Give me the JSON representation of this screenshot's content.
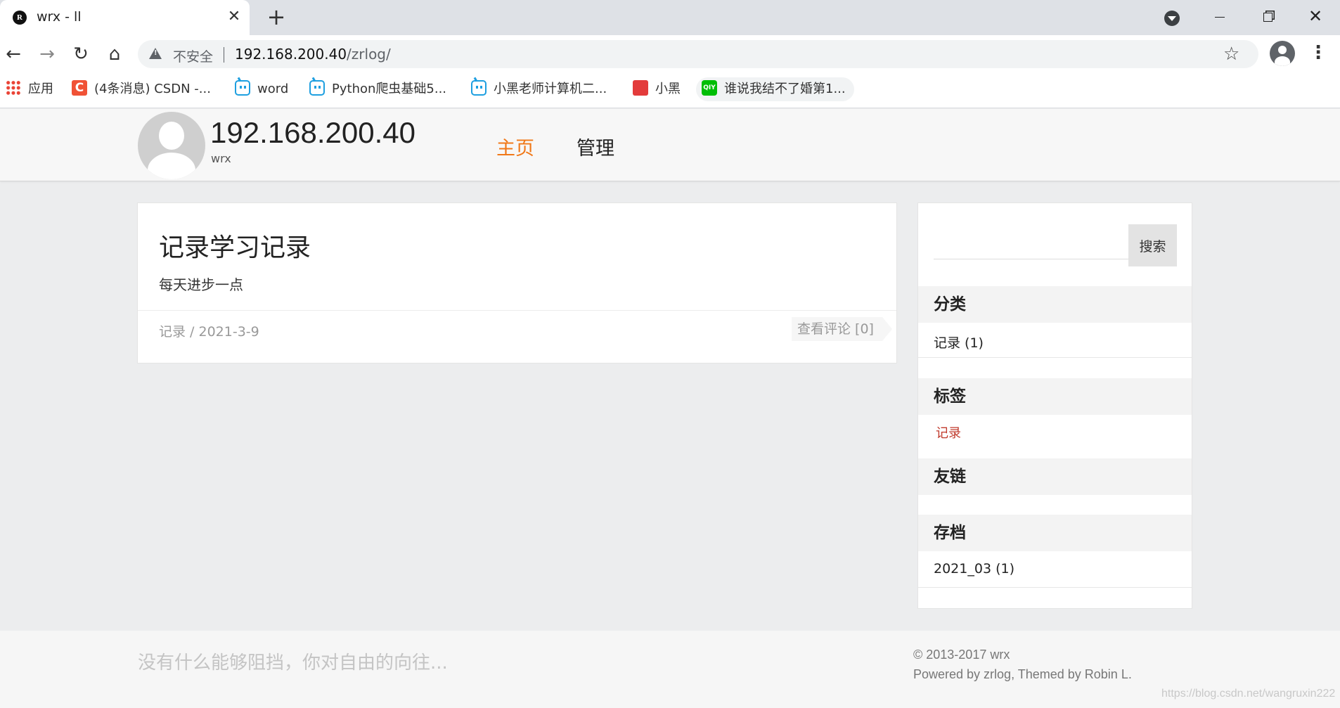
{
  "browser": {
    "tab_title": "wrx - ll",
    "tab_favicon_letter": "R",
    "new_tab": "+",
    "close_tab": "✕",
    "insecure_label": "不安全",
    "url_host": "192.168.200.40",
    "url_path": "/zrlog/",
    "bookmarks": [
      {
        "label": "应用",
        "icon": "apps-grid-icon"
      },
      {
        "label": "(4条消息) CSDN -...",
        "icon": "csdn-icon"
      },
      {
        "label": "word",
        "icon": "bilibili-icon"
      },
      {
        "label": "Python爬虫基础5...",
        "icon": "bilibili-icon"
      },
      {
        "label": "小黑老师计算机二...",
        "icon": "bilibili-icon"
      },
      {
        "label": "小黑",
        "icon": "bookmark-red-icon"
      },
      {
        "label": "谁说我结不了婚第1...",
        "icon": "iqiyi-icon"
      }
    ]
  },
  "site": {
    "title": "192.168.200.40",
    "subtitle": "wrx",
    "nav": {
      "home": "主页",
      "admin": "管理"
    },
    "accent_color": "#f07818"
  },
  "post": {
    "title": "记录学习记录",
    "excerpt": "每天进步一点",
    "meta": "记录 / 2021-3-9",
    "comments_link": "查看评论 [0]"
  },
  "sidebar": {
    "search_button": "搜索",
    "categories": {
      "heading": "分类",
      "items": [
        "记录 (1)"
      ]
    },
    "tags": {
      "heading": "标签",
      "items": [
        "记录"
      ]
    },
    "links": {
      "heading": "友链"
    },
    "archive": {
      "heading": "存档",
      "items": [
        "2021_03 (1)"
      ]
    }
  },
  "footer": {
    "motto": "没有什么能够阻挡，你对自由的向往...",
    "copyright": "© 2013-2017 wrx",
    "powered": "Powered by zrlog, Themed by Robin L."
  },
  "watermark": "https://blog.csdn.net/wangruxin222"
}
